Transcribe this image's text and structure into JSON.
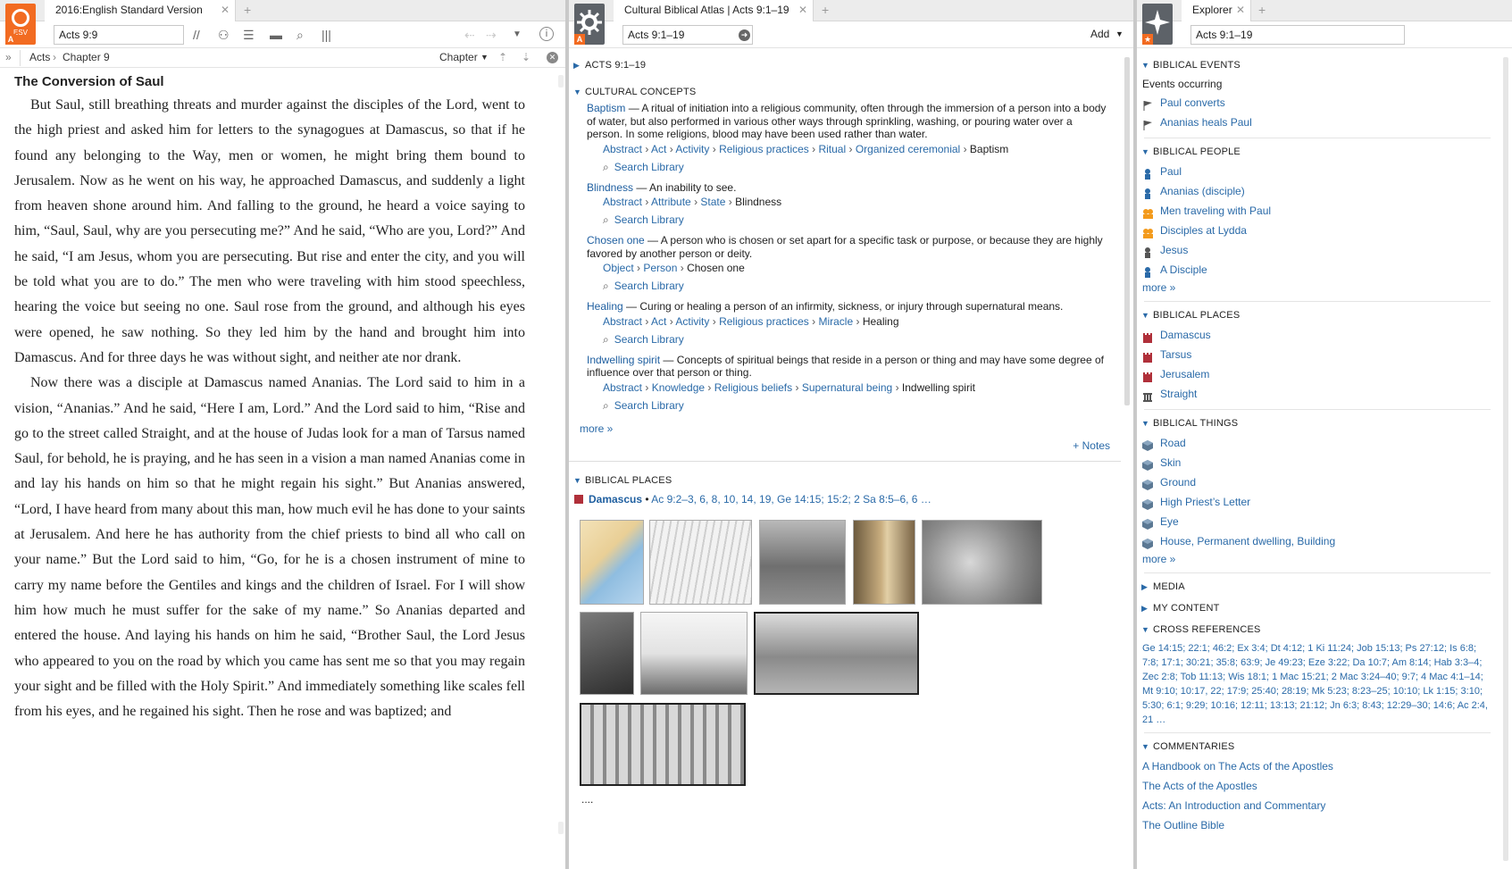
{
  "panels": {
    "bible": {
      "logo_text": "ESV",
      "tab_title": "2016:English Standard Version",
      "reference": "Acts 9:9",
      "breadcrumb": [
        "Acts",
        "Chapter 9"
      ],
      "nav_label": "Chapter",
      "heading": "The Conversion of Saul",
      "text": "But Saul, still breathing threats and murder against the disciples of the Lord, went to the high priest and asked him for letters to the synagogues at Damascus, so that if he found any belonging to the Way, men or women, he might bring them bound to Jerusalem. Now as he went on his way, he approached Damascus, and suddenly a light from heaven shone around him. And falling to the ground, he heard a voice saying to him, “Saul, Saul, why are you persecuting me?” And he said, “Who are you, Lord?” And he said, “I am Jesus, whom you are persecuting. But rise and enter the city, and you will be told what you are to do.” The men who were traveling with him stood speechless, hearing the voice but seeing no one. Saul rose from the ground, and although his eyes were opened, he saw nothing. So they led him by the hand and brought him into Damascus. And for three days he was without sight, and neither ate nor drank.",
      "text2": "Now there was a disciple at Damascus named Ananias. The Lord said to him in a vision, “Ananias.” And he said, “Here I am, Lord.” And the Lord said to him, “Rise and go to the street called Straight, and at the house of Judas look for a man of Tarsus named Saul, for behold, he is praying, and he has seen in a vision a man named Ananias come in and lay his hands on him so that he might regain his sight.” But Ananias answered, “Lord, I have heard from many about this man, how much evil he has done to your saints at Jerusalem. And here he has authority from the chief priests to bind all who call on your name.” But the Lord said to him, “Go, for he is a chosen instrument of mine to carry my name before the Gentiles and kings and the children of Israel. For I will show him how much he must suffer for the sake of my name.” So Ananias departed and entered the house. And laying his hands on him he said, “Brother Saul, the Lord Jesus who appeared to you on the road by which you came has sent me so that you may regain your sight and be filled with the Holy Spirit.” And immediately something like scales fell from his eyes, and he regained his sight. Then he rose and was baptized; and"
    },
    "atlas": {
      "tab_title": "Cultural Biblical Atlas | Acts 9:1–19",
      "reference": "Acts 9:1–19",
      "add_label": "Add",
      "section_ref": "ACTS 9:1–19",
      "concepts_header": "CULTURAL CONCEPTS",
      "concepts": [
        {
          "term": "Baptism",
          "def": " — A ritual of initiation into a religious community, often through the immersion of a person into a body of water, but also performed in various other ways through sprinkling, washing, or pouring water over a person. In some religions, blood may have been used rather than water.",
          "crumbs": [
            "Abstract",
            "Act",
            "Activity",
            "Religious practices",
            "Ritual",
            "Organized ceremonial"
          ],
          "last": "Baptism"
        },
        {
          "term": "Blindness",
          "def": " — An inability to see.",
          "crumbs": [
            "Abstract",
            "Attribute",
            "State"
          ],
          "last": "Blindness"
        },
        {
          "term": "Chosen one",
          "def": " — A person who is chosen or set apart for a specific task or purpose, or because they are highly favored by another person or deity.",
          "crumbs": [
            "Object",
            "Person"
          ],
          "last": "Chosen one"
        },
        {
          "term": "Healing",
          "def": " — Curing or healing a person of an infirmity, sickness, or injury through supernatural means.",
          "crumbs": [
            "Abstract",
            "Act",
            "Activity",
            "Religious practices",
            "Miracle"
          ],
          "last": "Healing"
        },
        {
          "term": "Indwelling spirit",
          "def": " — Concepts of spiritual beings that reside in a person or thing and may have some degree of influence over that person or thing.",
          "crumbs": [
            "Abstract",
            "Knowledge",
            "Religious beliefs",
            "Supernatural being"
          ],
          "last": "Indwelling spirit"
        }
      ],
      "search_library": "Search Library",
      "more": "more »",
      "notes": "+ Notes",
      "places_header": "BIBLICAL PLACES",
      "place_name": "Damascus",
      "place_refs": "Ac 9:2–3, 6, 8, 10, 14, 19, Ge 14:15; 15:2; 2 Sa 8:5–6, 6 …",
      "ellipsis": "...."
    },
    "explorer": {
      "tab_title": "Explorer",
      "reference": "Acts 9:1–19",
      "events_header": "BIBLICAL EVENTS",
      "events_sub": "Events occurring",
      "events": [
        "Paul converts",
        "Ananias heals Paul"
      ],
      "people_header": "BIBLICAL PEOPLE",
      "people": [
        "Paul",
        "Ananias (disciple)",
        "Men traveling with Paul",
        "Disciples at Lydda",
        "Jesus",
        "A Disciple"
      ],
      "places_header": "BIBLICAL PLACES",
      "places": [
        "Damascus",
        "Tarsus",
        "Jerusalem",
        "Straight"
      ],
      "things_header": "BIBLICAL THINGS",
      "things": [
        "Road",
        "Skin",
        "Ground",
        "High Priest’s Letter",
        "Eye",
        "House, Permanent dwelling, Building"
      ],
      "more": "more »",
      "media_header": "MEDIA",
      "mycontent_header": "MY CONTENT",
      "xref_header": "CROSS REFERENCES",
      "xrefs": "Ge 14:15; 22:1; 46:2; Ex 3:4; Dt 4:12; 1 Ki 11:24; Job 15:13; Ps 27:12; Is 6:8; 7:8; 17:1; 30:21; 35:8; 63:9; Je 49:23; Eze 3:22; Da 10:7; Am 8:14; Hab 3:3–4; Zec 2:8; Tob 11:13; Wis 18:1; 1 Mac 15:21; 2 Mac 3:24–40; 9:7; 4 Mac 4:1–14; Mt 9:10; 10:17, 22; 17:9; 25:40; 28:19; Mk 5:23; 8:23–25; 10:10; Lk 1:15; 3:10; 5:30; 6:1; 9:29; 10:16; 12:11; 13:13; 21:12; Jn 6:3; 8:43; 12:29–30; 14:6; Ac 2:4, 21 …",
      "commentaries_header": "COMMENTARIES",
      "commentaries": [
        "A Handbook on The Acts of the Apostles",
        "The Acts of the Apostles",
        "Acts: An Introduction and Commentary",
        "The Outline Bible"
      ]
    }
  },
  "colors": {
    "accent": "#2a6aa8",
    "brand": "#f26b21"
  }
}
